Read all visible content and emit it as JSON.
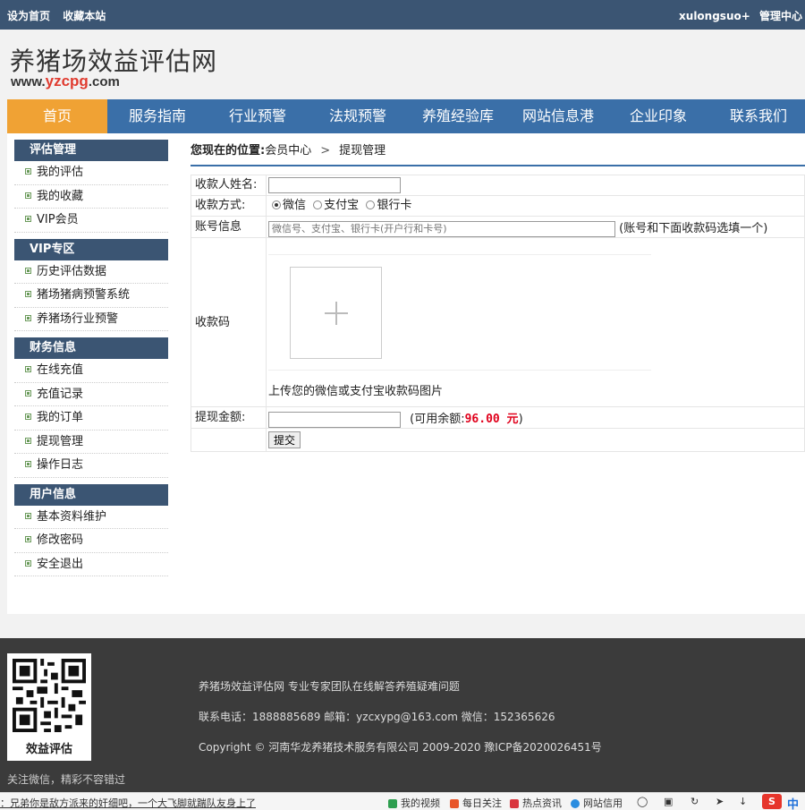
{
  "topbar": {
    "set_home": "设为首页",
    "bookmark": "收藏本站",
    "username": "xulongsuo+",
    "admin": "管理中心"
  },
  "header": {
    "title": "养猪场效益评估网",
    "url_prefix": "www.",
    "url_mid": "yzcpg",
    "url_suffix": ".com"
  },
  "nav": [
    {
      "label": "首页",
      "active": true
    },
    {
      "label": "服务指南"
    },
    {
      "label": "行业预警"
    },
    {
      "label": "法规预警"
    },
    {
      "label": "养殖经验库"
    },
    {
      "label": "网站信息港"
    },
    {
      "label": "企业印象"
    },
    {
      "label": "联系我们"
    }
  ],
  "sidebar": [
    {
      "title": "评估管理",
      "items": [
        "我的评估",
        "我的收藏",
        "VIP会员"
      ]
    },
    {
      "title": "VIP专区",
      "items": [
        "历史评估数据",
        "猪场猪病预警系统",
        "养猪场行业预警"
      ]
    },
    {
      "title": "财务信息",
      "items": [
        "在线充值",
        "充值记录",
        "我的订单",
        "提现管理",
        "操作日志"
      ]
    },
    {
      "title": "用户信息",
      "items": [
        "基本资料维护",
        "修改密码",
        "安全退出"
      ]
    }
  ],
  "breadcrumb": {
    "prefix": "您现在的位置:",
    "parent": "会员中心",
    "separator": ">",
    "current": "提现管理"
  },
  "form": {
    "payee_label": "收款人姓名:",
    "payee_value": "",
    "method_label": "收款方式:",
    "methods": [
      "微信",
      "支付宝",
      "银行卡"
    ],
    "account_label": "账号信息",
    "account_placeholder": "微信号、支付宝、银行卡(开户行和卡号)",
    "account_hint": "(账号和下面收款码选填一个)",
    "qrcode_label": "收款码",
    "upload_hint": "上传您的微信或支付宝收款码图片",
    "amount_label": "提现金额:",
    "amount_value": "",
    "balance_prefix": "(可用余额:",
    "balance_value": "96.00 元",
    "balance_suffix": ")",
    "submit": "提交"
  },
  "footer": {
    "qr_label": "效益评估",
    "follow_text": "关注微信，精彩不容错过",
    "line1": "养猪场效益评估网 专业专家团队在线解答养殖疑难问题",
    "line2": "联系电话：1888885689 邮箱：yzcxypg@163.com 微信：152365626",
    "line3": "Copyright © 河南华龙养猪技术服务有限公司 2009-2020 豫ICP备2020026451号"
  },
  "statusbar": {
    "news": "：兄弟你是敌方派来的奸细吧，一个大飞脚就踹队友身上了",
    "items": [
      "我的视频",
      "每日关注",
      "热点资讯",
      "网站信用"
    ],
    "ime": "中",
    "colors": {
      "video": "#2e9e4f",
      "daily": "#e8562a",
      "hot": "#d9363e",
      "credit": "#2a8de0"
    }
  }
}
